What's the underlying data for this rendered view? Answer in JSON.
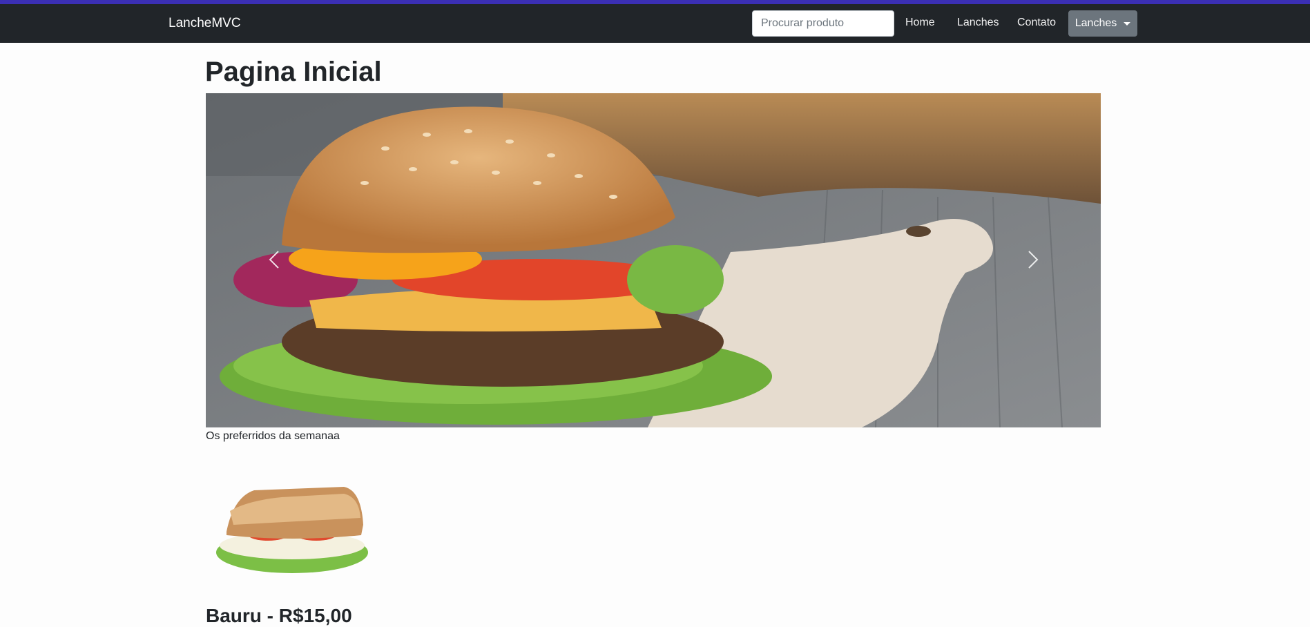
{
  "navbar": {
    "brand": "LancheMVC",
    "search_placeholder": "Procurar produto",
    "links": [
      "Home",
      "Lanches",
      "Contato"
    ],
    "dropdown_label": "Lanches"
  },
  "main": {
    "title": "Pagina Inicial",
    "carousel_caption": "Os preferridos da semanaa",
    "product_title": "Bauru - R$15,00"
  },
  "colors": {
    "navbar_bg": "#212529",
    "top_accent": "#3b2fb4",
    "dropdown_bg": "#6c757d"
  },
  "icons": {
    "carousel_prev": "chevron-left-icon",
    "carousel_next": "chevron-right-icon",
    "dropdown": "caret-down-icon"
  }
}
